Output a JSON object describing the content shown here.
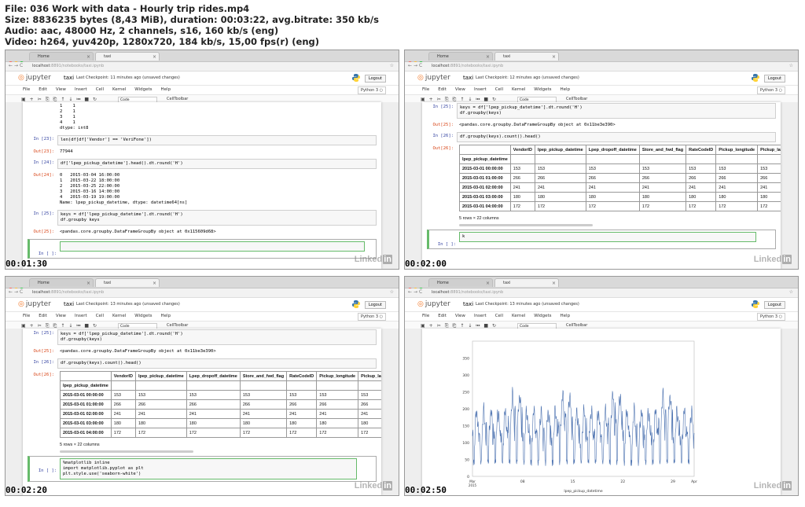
{
  "meta": {
    "line1": "File: 036 Work with data - Hourly trip rides.mp4",
    "line2": "Size: 8836235 bytes (8,43 MiB), duration: 00:03:22, avg.bitrate: 350 kb/s",
    "line3": "Audio: aac, 48000 Hz, 2 channels, s16, 160 kb/s (eng)",
    "line4": "Video: h264, yuv420p, 1280x720, 184 kb/s, 15,00 fps(r) (eng)"
  },
  "browser": {
    "tab_home": "Home",
    "tab_taxi": "taxi",
    "url_host": "localhost",
    "url_path": ":8891/notebooks/taxi.ipynb"
  },
  "notebook": {
    "logo": "jupyter",
    "name": "taxi",
    "logout": "Logout",
    "kernel": "Python 3",
    "menu": [
      "File",
      "Edit",
      "View",
      "Insert",
      "Cell",
      "Kernel",
      "Widgets",
      "Help"
    ],
    "cell_type": "Code",
    "celltoolbar": "CellToolbar"
  },
  "frames": [
    {
      "timestamp": "00:01:30",
      "checkpoint": "Last Checkpoint: 11 minutes ago (unsaved changes)",
      "out22_lines": [
        "1    1",
        "2    1",
        "3    1",
        "4    1",
        "dtype: int8"
      ],
      "in23_prompt": "In [23]:",
      "in23_code": "len(df[df['Vendor'] == 'VeriFone'])",
      "out23_prompt": "Out[23]:",
      "out23_text": "77944",
      "in24_prompt": "In [24]:",
      "in24_code": "df['lpep_pickup_datetime'].head().dt.round('H')",
      "out24_prompt": "Out[24]:",
      "out24_lines": [
        "0   2015-03-04 16:00:00",
        "1   2015-03-22 18:00:00",
        "2   2015-03-25 22:00:00",
        "3   2015-03-16 14:00:00",
        "4   2015-03-19 19:00:00",
        "Name: lpep_pickup_datetime, dtype: datetime64[ns]"
      ],
      "in25_prompt": "In [25]:",
      "in25_code": "keys = df['lpep_pickup_datetime'].dt.round('H')\ndf.groupby keys",
      "out25_prompt": "Out[25]:",
      "out25_text": "<pandas.core.groupby.DataFrameGroupBy object at 0x115609d68>",
      "empty_prompt": "In [ ]:"
    },
    {
      "timestamp": "00:02:00",
      "checkpoint": "Last Checkpoint: 12 minutes ago (unsaved changes)",
      "empty_code": "k"
    },
    {
      "timestamp": "00:02:20",
      "checkpoint": "Last Checkpoint: 13 minutes ago (unsaved changes)",
      "in_mpl_code": "%matplotlib inline\nimport matplotlib.pyplot as plt\nplt.style.use('seaborn-white')"
    },
    {
      "timestamp": "00:02:50",
      "checkpoint": "Last Checkpoint: 13 minutes ago (unsaved changes)"
    }
  ],
  "groupby": {
    "in25_prompt": "In [25]:",
    "in25_code": "keys = df['lpep_pickup_datetime'].dt.round('H')\ndf.groupby(keys)",
    "out25_prompt": "Out[25]:",
    "out25_text": "<pandas.core.groupby.DataFrameGroupBy object at 0x11be3e390>",
    "in26_prompt": "In [26]:",
    "in26_code": "df.groupby(keys).count().head()",
    "out26_prompt": "Out[26]:",
    "columns": [
      "VendorID",
      "lpep_pickup_datetime",
      "Lpep_dropoff_datetime",
      "Store_and_fwd_flag",
      "RateCodeID",
      "Pickup_longitude",
      "Pickup_latitu"
    ],
    "index_name": "lpep_pickup_datetime",
    "rows": [
      {
        "index": "2015-03-01 00:00:00",
        "values": [
          "153",
          "153",
          "153",
          "153",
          "153",
          "153",
          "153"
        ]
      },
      {
        "index": "2015-03-01 01:00:00",
        "values": [
          "266",
          "266",
          "266",
          "266",
          "266",
          "266",
          "266"
        ]
      },
      {
        "index": "2015-03-01 02:00:00",
        "values": [
          "241",
          "241",
          "241",
          "241",
          "241",
          "241",
          "241"
        ]
      },
      {
        "index": "2015-03-01 03:00:00",
        "values": [
          "180",
          "180",
          "180",
          "180",
          "180",
          "180",
          "180"
        ]
      },
      {
        "index": "2015-03-01 04:00:00",
        "values": [
          "172",
          "172",
          "172",
          "172",
          "172",
          "172",
          "172"
        ]
      }
    ],
    "shape": "5 rows × 22 columns",
    "empty_prompt": "In [ ]:"
  },
  "plot": {
    "ylim": [
      0,
      400
    ],
    "yticks": [
      "0",
      "50",
      "100",
      "150",
      "200",
      "250",
      "300",
      "350"
    ],
    "xticks": [
      "08",
      "15",
      "22",
      "29"
    ],
    "x_first": "Mar\n2015",
    "x_last": "Apr",
    "xlabel": "lpep_pickup_datetime",
    "line_color": "#4c72b0"
  },
  "watermark": {
    "text": "Linked",
    "box": "in"
  }
}
